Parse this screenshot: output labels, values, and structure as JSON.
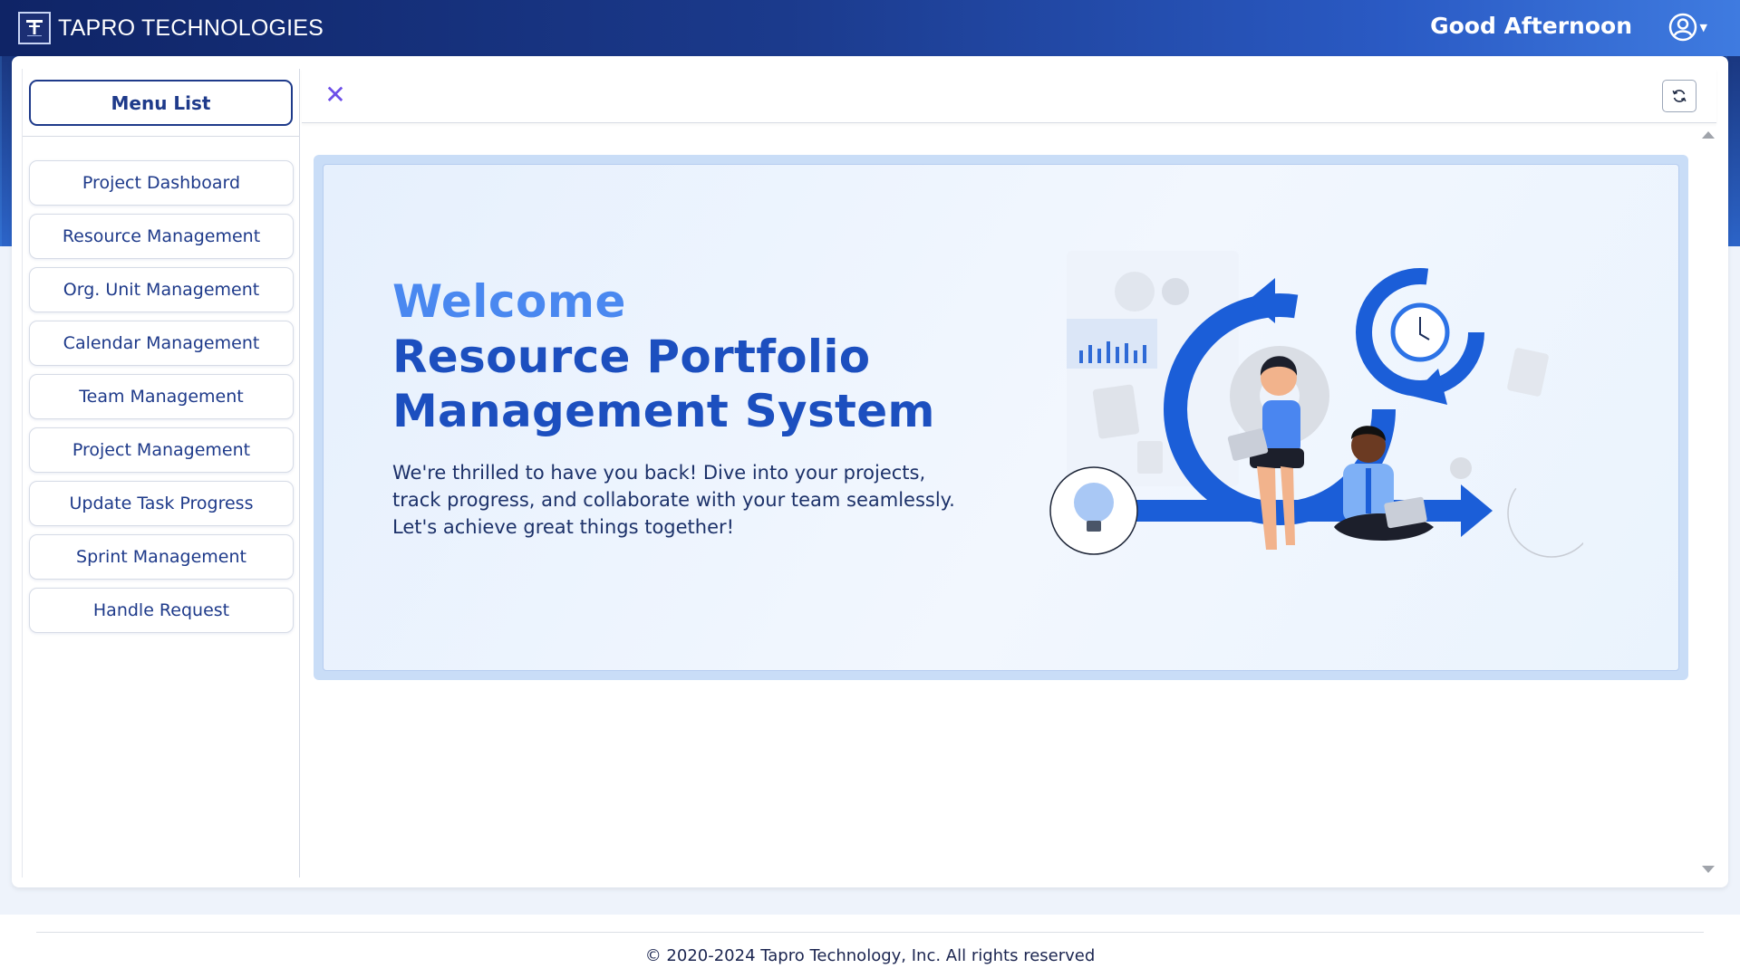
{
  "header": {
    "brand": "TAPRO TECHNOLOGIES",
    "greeting": "Good Afternoon",
    "logo_icon": "tapro-logo-icon",
    "user_icon": "user-circle-icon",
    "caret_icon": "caret-down-icon"
  },
  "sidebar": {
    "title": "Menu List",
    "items": [
      {
        "label": "Project Dashboard"
      },
      {
        "label": "Resource Management"
      },
      {
        "label": "Org. Unit Management"
      },
      {
        "label": "Calendar Management"
      },
      {
        "label": "Team Management"
      },
      {
        "label": "Project Management"
      },
      {
        "label": "Update Task Progress"
      },
      {
        "label": "Sprint Management"
      },
      {
        "label": "Handle Request"
      }
    ]
  },
  "toolbar": {
    "close_icon": "close-icon",
    "refresh_icon": "refresh-icon"
  },
  "welcome": {
    "heading": "Welcome",
    "subheading": "Resource Portfolio Management System",
    "body": "We're thrilled to have you back! Dive into your projects, track progress, and collaborate with your team seamlessly. Let's achieve great things together!"
  },
  "footer": {
    "copyright": "© 2020-2024 Tapro Technology, Inc. All rights reserved"
  },
  "colors": {
    "accent": "#1e3a8a",
    "heading_light": "#4a88f0",
    "heading_dark": "#1c4fbf",
    "close": "#6d4ee8"
  }
}
